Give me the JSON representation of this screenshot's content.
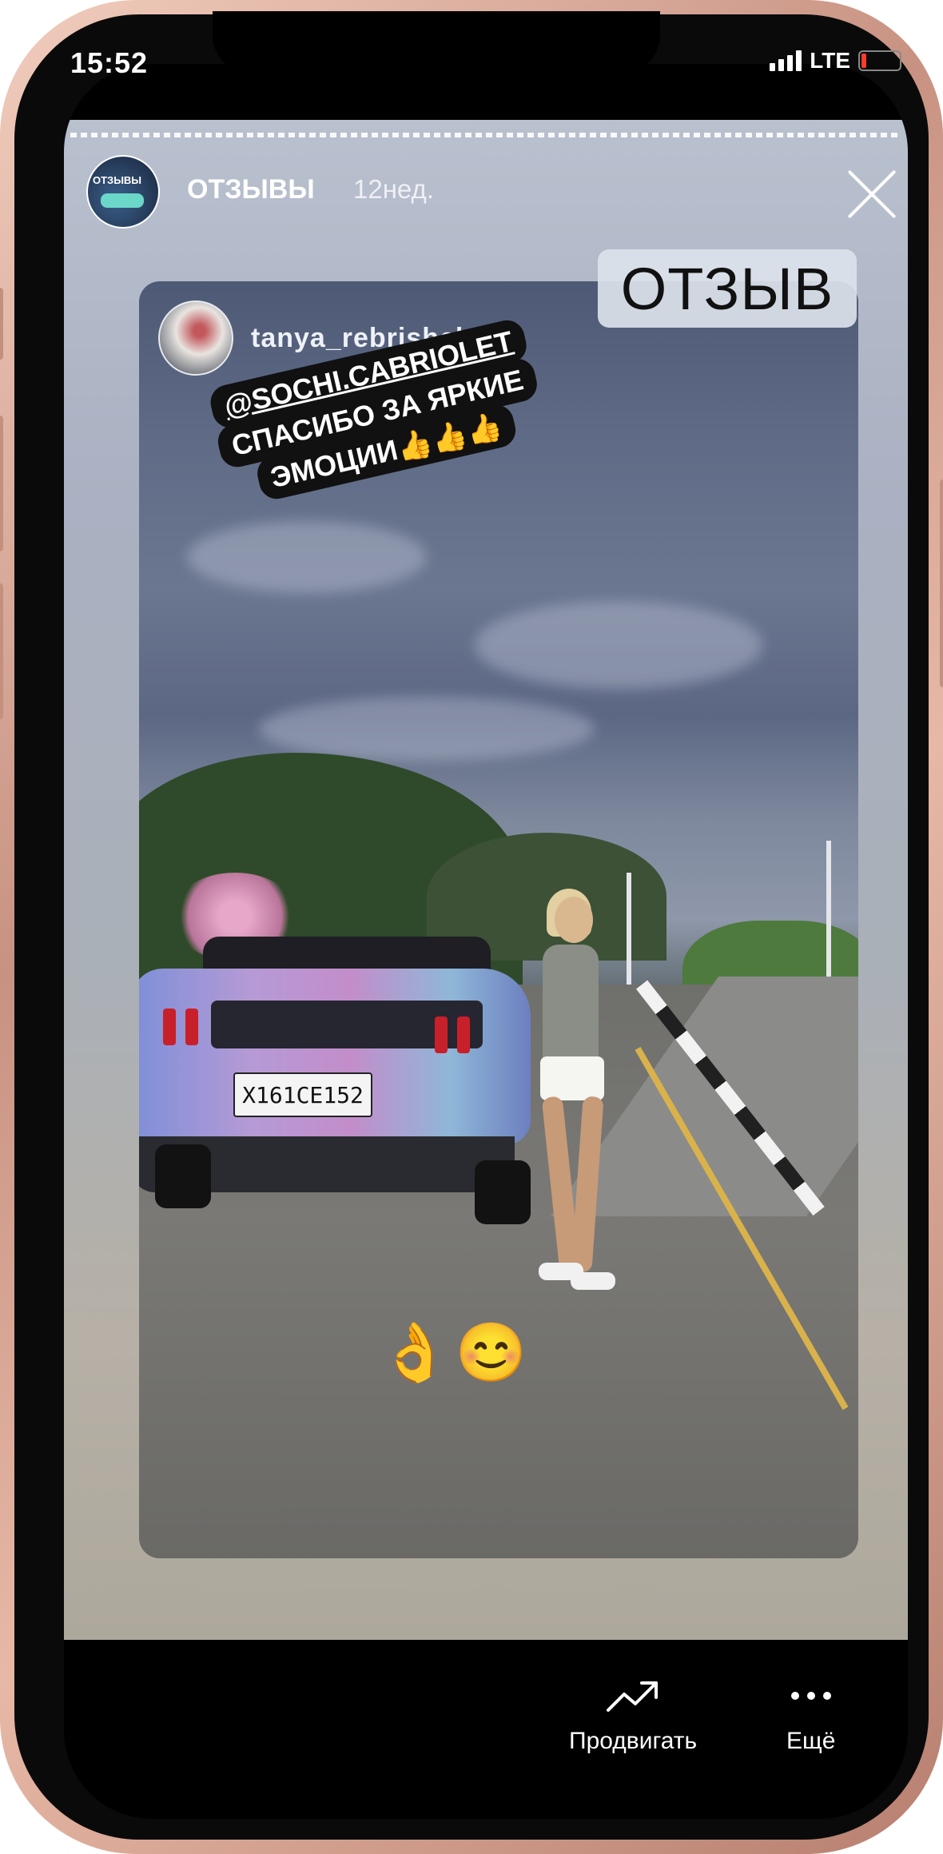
{
  "status_bar": {
    "time": "15:52",
    "network": "LTE"
  },
  "story": {
    "avatar_label": "ОТЗЫВЫ",
    "username": "ОТЗЫВЫ",
    "age": "12нед.",
    "badge": "ОТЗЫВ",
    "close_icon": "close-icon"
  },
  "post": {
    "username": "tanya_rebrishcheva",
    "sticker_mention": "@SOCHI.CABRIOLET",
    "sticker_line2": "СПАСИБО ЗА ЯРКИЕ",
    "sticker_line3": "ЭМОЦИИ👍👍👍",
    "plate": "Х161СЕ152",
    "emoji_caption": "👌😊"
  },
  "bottom_bar": {
    "promote_label": "Продвигать",
    "promote_icon": "trending-up-icon",
    "more_label": "Ещё",
    "more_icon": "more-horizontal-icon"
  },
  "colors": {
    "frame": "#c89282",
    "story_bg": "#aab0b8",
    "sticker_bg": "#111111"
  }
}
